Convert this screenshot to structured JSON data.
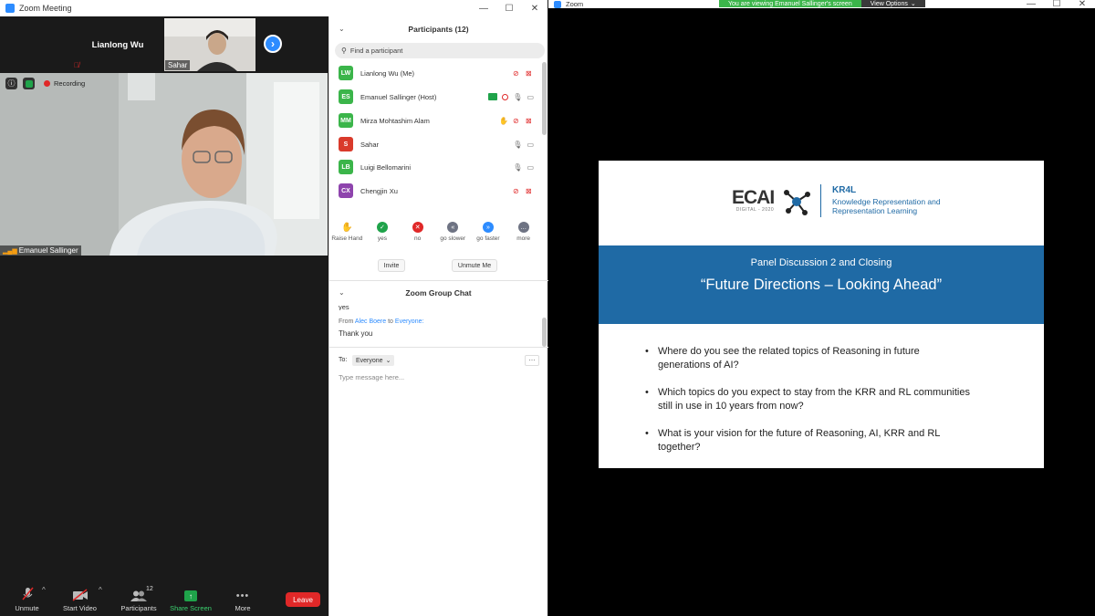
{
  "left_window": {
    "title": "Zoom Meeting",
    "thumbnails": [
      {
        "name": "Lianlong Wu"
      },
      {
        "name": "Sahar"
      }
    ],
    "main_video": {
      "name": "Emanuel Sallinger",
      "recording_label": "Recording"
    },
    "toolbar": {
      "unmute": "Unmute",
      "start_video": "Start Video",
      "participants": "Participants",
      "participants_count": "12",
      "share_screen": "Share Screen",
      "more": "More",
      "leave": "Leave"
    }
  },
  "participants_panel": {
    "title": "Participants (12)",
    "search_placeholder": "Find a participant",
    "participants": [
      {
        "initials": "LW",
        "name": "Lianlong Wu (Me)",
        "color": "#3bb54a"
      },
      {
        "initials": "ES",
        "name": "Emanuel Sallinger (Host)",
        "color": "#3bb54a"
      },
      {
        "initials": "MM",
        "name": "Mirza Mohtashim Alam",
        "color": "#3bb54a"
      },
      {
        "initials": "S",
        "name": "Sahar",
        "color": "#d93a2b"
      },
      {
        "initials": "LB",
        "name": "Luigi Bellomarini",
        "color": "#3bb54a"
      },
      {
        "initials": "CX",
        "name": "Chengjin Xu",
        "color": "#8e44ad"
      }
    ],
    "reactions": [
      {
        "label": "Raise Hand",
        "icon": "hand-icon",
        "color": "#2d8cff"
      },
      {
        "label": "yes",
        "icon": "check-icon",
        "color": "#1fa34a"
      },
      {
        "label": "no",
        "icon": "x-icon",
        "color": "#e02828"
      },
      {
        "label": "go slower",
        "icon": "rewind-icon",
        "color": "#6e7383"
      },
      {
        "label": "go faster",
        "icon": "fast-forward-icon",
        "color": "#2d8cff"
      },
      {
        "label": "more",
        "icon": "more-icon",
        "color": "#6e7383"
      }
    ],
    "invite": "Invite",
    "unmute_me": "Unmute Me"
  },
  "chat": {
    "title": "Zoom Group Chat",
    "partial_line": "yes",
    "from_prefix": "From",
    "from_name": "Alec Boere",
    "to_word": "to",
    "to_name": "Everyone:",
    "message": "Thank you",
    "to_label": "To:",
    "recipient": "Everyone",
    "input_placeholder": "Type message here..."
  },
  "right_window": {
    "title": "Zoom",
    "banner": "You are viewing Emanuel Sallinger's screen",
    "view_options": "View Options",
    "slide": {
      "logo_main": "ECAI",
      "logo_sub": "DIGITAL - 2020",
      "kr4l": "KR4L",
      "kr4l_line1": "Knowledge Representation and",
      "kr4l_line2": "Representation Learning",
      "subtitle": "Panel Discussion 2 and Closing",
      "title": "“Future Directions – Looking Ahead”",
      "bullets": [
        {
          "line1": "Where do you see the related topics of Reasoning in future",
          "line2": "generations of AI?"
        },
        {
          "line1": "Which topics do you expect to stay from the KRR and RL communities",
          "line2": "still in use in 10 years from now?"
        },
        {
          "line1": "What is your vision for the future of Reasoning, AI, KRR and RL",
          "line2": "together?"
        }
      ]
    }
  }
}
